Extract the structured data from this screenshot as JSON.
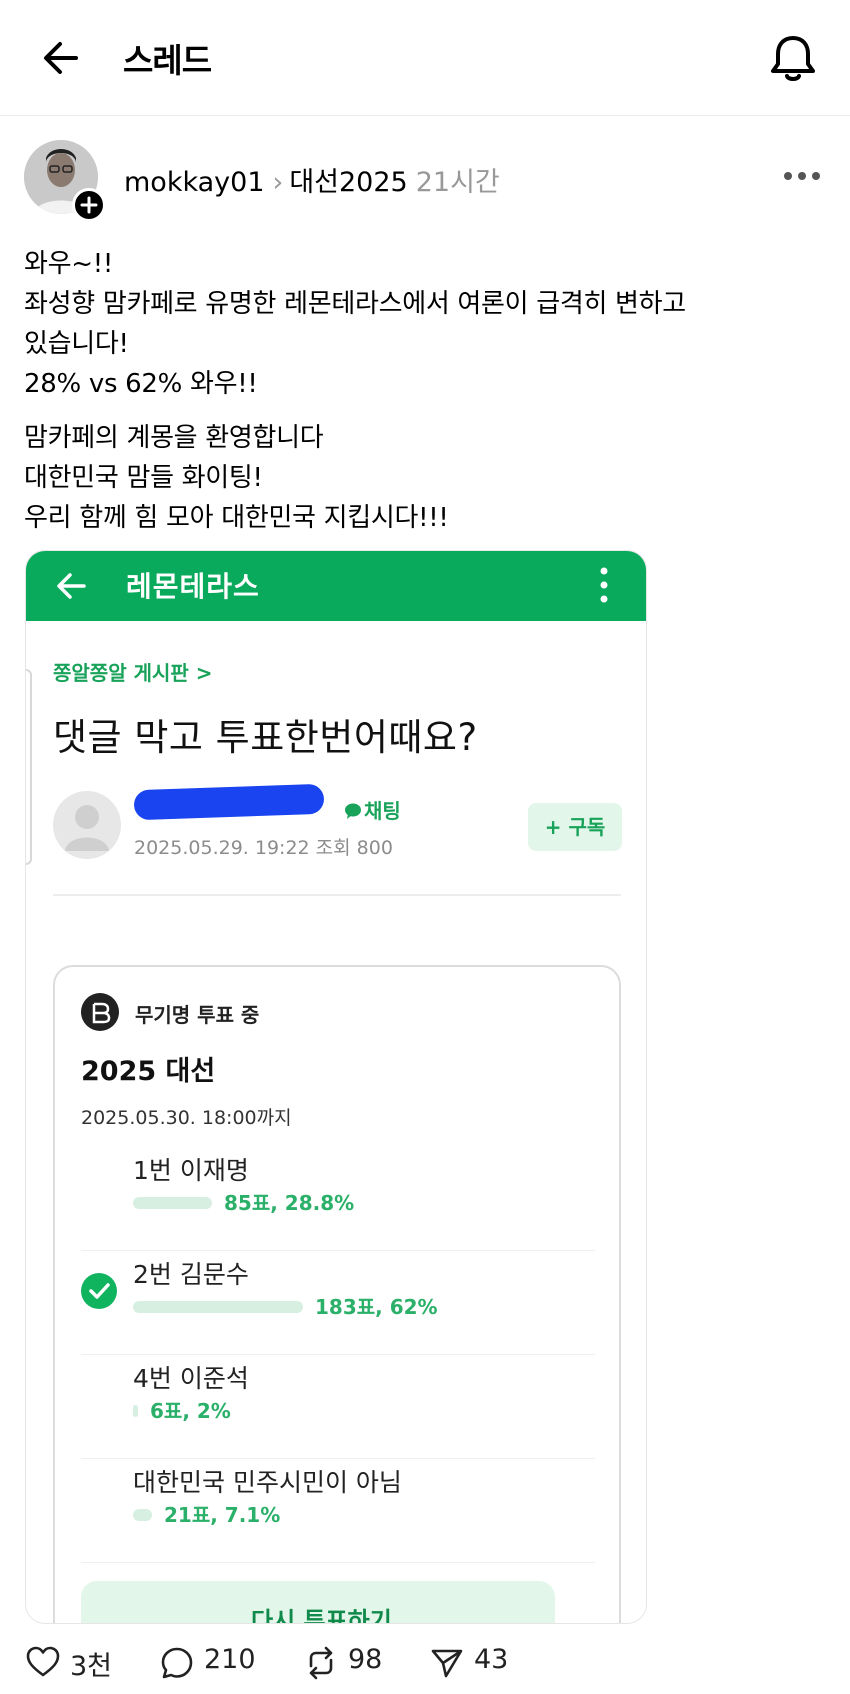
{
  "header": {
    "title": "스레드"
  },
  "post": {
    "author": "mokkay01",
    "topic": "대선2025",
    "time": "21시간",
    "text_paragraphs": [
      [
        "와우~!!",
        "좌성향 맘카페로 유명한 레몬테라스에서 여론이 급격히 변하고",
        "있습니다!",
        "28% vs 62% 와우!!"
      ],
      [
        "맘카페의 계몽을 환영합니다",
        "대한민국 맘들 화이팅!",
        "우리 함께 힘 모아 대한민국 지킵시다!!!"
      ]
    ]
  },
  "embed": {
    "app_title": "레몬테라스",
    "board": "쫑알쫑알 게시판 >",
    "question": "댓글 막고 투표한번어때요?",
    "chat_label": "채팅",
    "meta": "2025.05.29. 19:22  조회 800",
    "subscribe_label": "+ 구독",
    "vote": {
      "status": "무기명 투표 중",
      "title": "2025 대선",
      "deadline": "2025.05.30. 18:00까지",
      "options": [
        {
          "name": "1번 이재명",
          "count": "85표, 28.8%",
          "share": 0.288,
          "checked": false
        },
        {
          "name": "2번 김문수",
          "count": "183표, 62%",
          "share": 0.62,
          "checked": true
        },
        {
          "name": "4번 이준석",
          "count": "6표, 2%",
          "share": 0.02,
          "checked": false
        },
        {
          "name": "대한민국 민주시민이 아님",
          "count": "21표, 7.1%",
          "share": 0.071,
          "checked": false
        }
      ],
      "revote_label": "다시 투표하기"
    }
  },
  "actions": {
    "likes": "3천",
    "comments": "210",
    "reposts": "98",
    "shares": "43"
  },
  "colors": {
    "brand_green": "#09aa5c",
    "vote_text_green": "#2bb06a",
    "redaction_blue": "#1a44f0"
  }
}
